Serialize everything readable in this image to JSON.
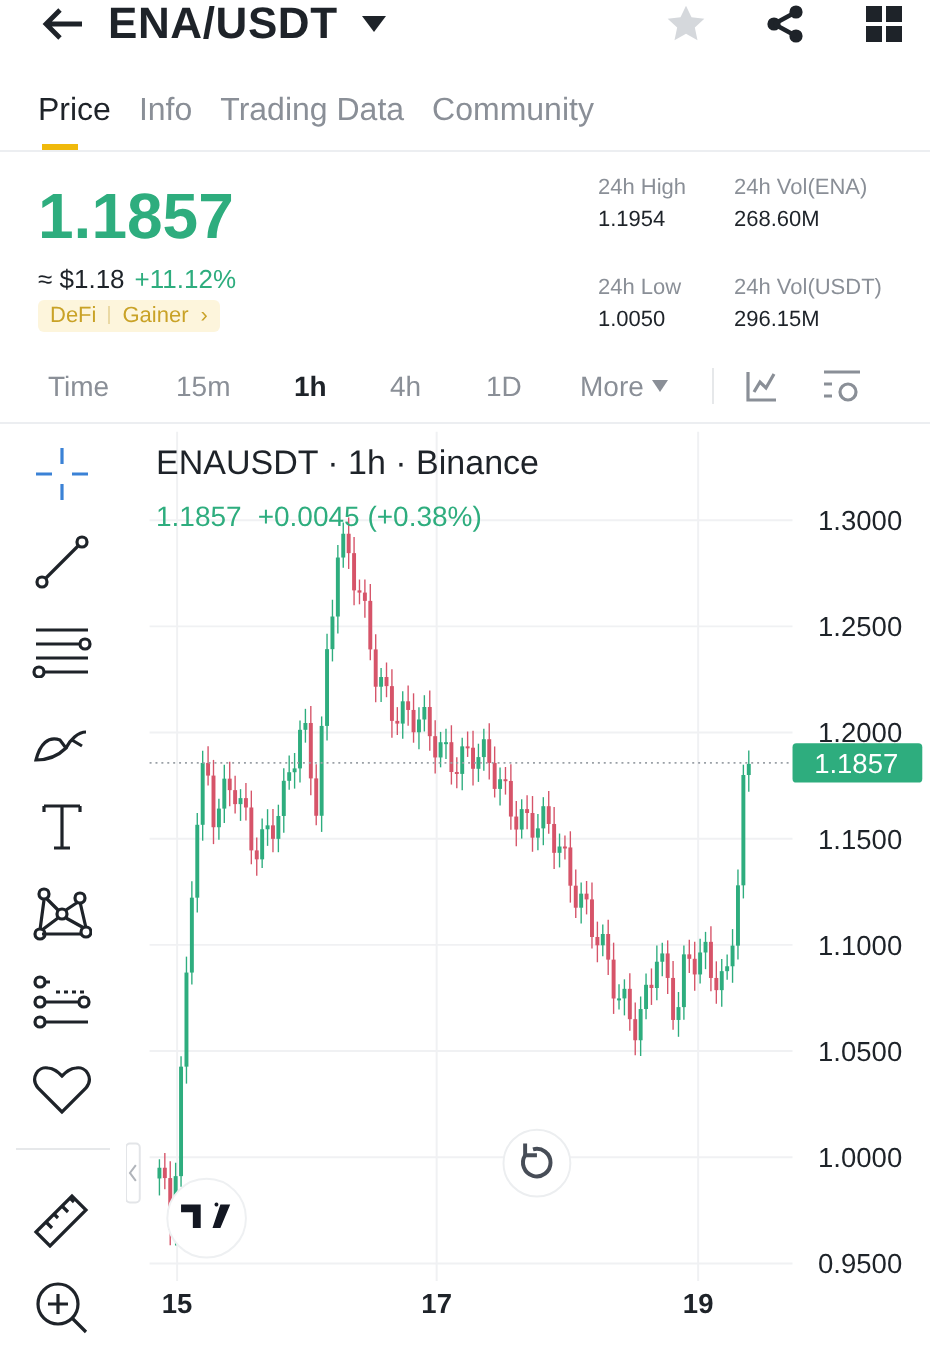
{
  "header": {
    "title": "ENA/USDT",
    "favorite": false
  },
  "tabs": [
    {
      "label": "Price",
      "selected": true
    },
    {
      "label": "Info",
      "selected": false
    },
    {
      "label": "Trading Data",
      "selected": false
    },
    {
      "label": "Community",
      "selected": false
    }
  ],
  "price": {
    "last": "1.1857",
    "approx": "≈ $1.18",
    "change": "+11.12%",
    "tags": [
      "DeFi",
      "Gainer"
    ],
    "tags_arrow": "›"
  },
  "stats": [
    {
      "label": "24h High",
      "value": "1.1954"
    },
    {
      "label": "24h Vol(ENA)",
      "value": "268.60M"
    },
    {
      "label": "24h Low",
      "value": "1.0050"
    },
    {
      "label": "24h Vol(USDT)",
      "value": "296.15M"
    }
  ],
  "intervals": [
    {
      "label": "Time",
      "selected": false
    },
    {
      "label": "15m",
      "selected": false
    },
    {
      "label": "1h",
      "selected": true
    },
    {
      "label": "4h",
      "selected": false
    },
    {
      "label": "1D",
      "selected": false
    }
  ],
  "more": {
    "label": "More"
  },
  "chart": {
    "title": "ENAUSDT · 1h · Binance",
    "legend_price": "1.1857",
    "legend_change": "+0.0045 (+0.38%)",
    "yticks": [
      "1.3000",
      "1.2500",
      "1.2000",
      "1.1500",
      "1.1000",
      "1.0500",
      "1.0000",
      "0.9500"
    ],
    "xticks": [
      "15",
      "17",
      "19"
    ],
    "current_price": "1.1857"
  }
}
